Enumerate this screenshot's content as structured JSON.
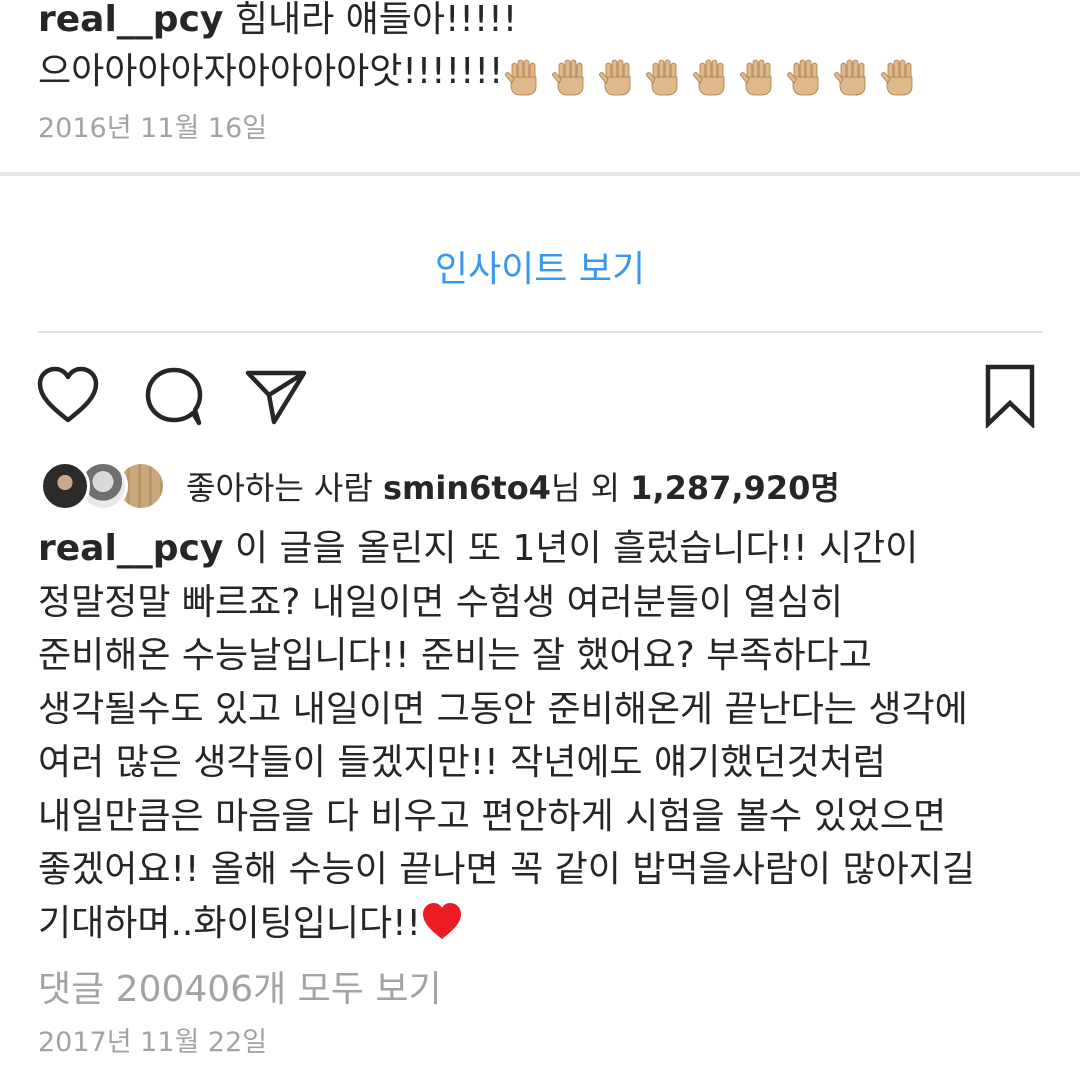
{
  "prev_post": {
    "username": "real__pcy",
    "line1_text": " 힘내라 얘들아!!!!!",
    "line2_text": "으아아아아자아아아아앗!!!!!!!",
    "hand_emoji_count": 9,
    "date": "2016년 11월 16일"
  },
  "insights": {
    "label": "인사이트 보기"
  },
  "likes": {
    "prefix": "좋아하는 사람 ",
    "user": "smin6to4",
    "middle": "님 외 ",
    "count": "1,287,920",
    "suffix": "명"
  },
  "caption": {
    "username": "real__pcy",
    "lines": [
      " 이 글을 올린지 또 1년이 흘렀습니다!! 시간이",
      "정말정말 빠르죠? 내일이면 수험생 여러분들이 열심히",
      "준비해온 수능날입니다!! 준비는 잘 했어요? 부족하다고",
      "생각될수도 있고 내일이면 그동안 준비해온게 끝난다는 생각에",
      "여러 많은 생각들이 들겠지만!! 작년에도 얘기했던것처럼",
      "내일만큼은 마음을 다 비우고 편안하게 시험을 볼수 있었으면",
      "좋겠어요!! 올해 수능이 끝나면 꼭 같이 밥먹을사람이 많아지길",
      "기대하며..화이팅입니다!!"
    ],
    "end_emoji": "red-heart-icon"
  },
  "comments": {
    "label": "댓글 200406개 모두 보기"
  },
  "post_date": "2017년 11월 22일",
  "colors": {
    "link_blue": "#3897f0",
    "text_dark": "#262626",
    "text_gray": "#a3a3a3",
    "heart_red": "#ed1c24",
    "skin_tone": "#e0b98a"
  },
  "icons": {
    "like": "heart-outline-icon",
    "comment": "comment-bubble-icon",
    "share": "paper-plane-icon",
    "save": "bookmark-outline-icon"
  }
}
